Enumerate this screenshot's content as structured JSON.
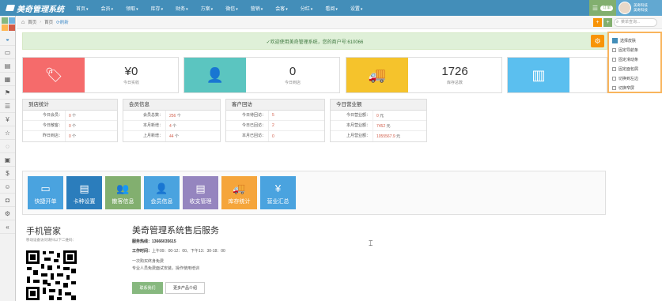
{
  "app": {
    "title": "美奇管理系统",
    "user_line1": "美奇科技",
    "user_line2": "美奇科技",
    "badge": "订单"
  },
  "menu": [
    "首页",
    "会员",
    "领取",
    "库存",
    "财务",
    "方案",
    "微信",
    "营销",
    "会客",
    "分红",
    "看阅",
    "设置"
  ],
  "sidebar_icons": [
    "dashboard-icon",
    "desktop-icon",
    "card-icon",
    "calendar-icon",
    "flag-icon",
    "list-icon",
    "yen-icon",
    "star-icon",
    "chat-icon",
    "gift-icon",
    "dollar-icon",
    "smile-icon",
    "photo-icon",
    "gear-icon",
    "more-icon"
  ],
  "breadcrumb": {
    "home": "首页",
    "current": "首页",
    "refresh": "刷新"
  },
  "search": {
    "placeholder": "菜单查询..."
  },
  "welcome": {
    "text": "✓欢迎使用美奇管理系统，您的商户号:610066"
  },
  "skin_panel": {
    "items": [
      "选择皮肤",
      "固定导航条",
      "固定滑动条",
      "固定面包屑",
      "切换到左边",
      "切换窄屏"
    ],
    "accent": "#438eb9"
  },
  "stats": [
    {
      "value": "¥0",
      "label": "今日实收",
      "color": "#f56b6b"
    },
    {
      "value": "0",
      "label": "今日到店",
      "color": "#5bc5c0"
    },
    {
      "value": "1726",
      "label": "库存总数",
      "color": "#f5c32c"
    },
    {
      "value": "",
      "label": "",
      "color": "#5bbfef"
    }
  ],
  "tables": [
    {
      "title": "到店统计",
      "rows": [
        {
          "k": "今日会员：",
          "v": "0",
          "u": "个"
        },
        {
          "k": "今日散客：",
          "v": "0",
          "u": "个"
        },
        {
          "k": "昨日到店：",
          "v": "0",
          "u": "个"
        }
      ]
    },
    {
      "title": "会员信息",
      "rows": [
        {
          "k": "会员总数：",
          "v": "256",
          "u": "个"
        },
        {
          "k": "本月新增：",
          "v": "4",
          "u": "个"
        },
        {
          "k": "上月新增：",
          "v": "44",
          "u": "个"
        }
      ]
    },
    {
      "title": "客户回访",
      "rows": [
        {
          "k": "今日待回访：",
          "v": "5",
          "u": ""
        },
        {
          "k": "今日已回访：",
          "v": "2",
          "u": ""
        },
        {
          "k": "本月已回访：",
          "v": "0",
          "u": ""
        }
      ]
    },
    {
      "title": "今日营业额",
      "rows": [
        {
          "k": "今日营业额：",
          "v": "0",
          "u": "元"
        },
        {
          "k": "本月营业额：",
          "v": "7452",
          "u": "元"
        },
        {
          "k": "上月营业额：",
          "v": "1055567.9",
          "u": "元"
        }
      ]
    }
  ],
  "quick": [
    {
      "label": "快捷开单",
      "color": "#4aa3df"
    },
    {
      "label": "卡种设置",
      "color": "#2b7dbc"
    },
    {
      "label": "散客信息",
      "color": "#82af6f"
    },
    {
      "label": "会员信息",
      "color": "#4aa3df"
    },
    {
      "label": "收支管理",
      "color": "#9585bf"
    },
    {
      "label": "库存统计",
      "color": "#f5a53b"
    },
    {
      "label": "营业汇总",
      "color": "#4aa3df"
    }
  ],
  "mobile": {
    "title": "手机管家",
    "subtitle": "移动设备访问请扫以下二维码："
  },
  "service": {
    "title": "美奇管理系统售后服务",
    "hotline_label": "服务热线：",
    "hotline": "13666035615",
    "hours_label": "工作时间：",
    "hours": "上午09：00-12：00、下午13：30-18：00",
    "note1": "一次购买终身免费",
    "note2": "专业人员免费面试安装，操作使用培训",
    "contact_btn": "联系我们",
    "more_btn": "更多产品介绍"
  }
}
